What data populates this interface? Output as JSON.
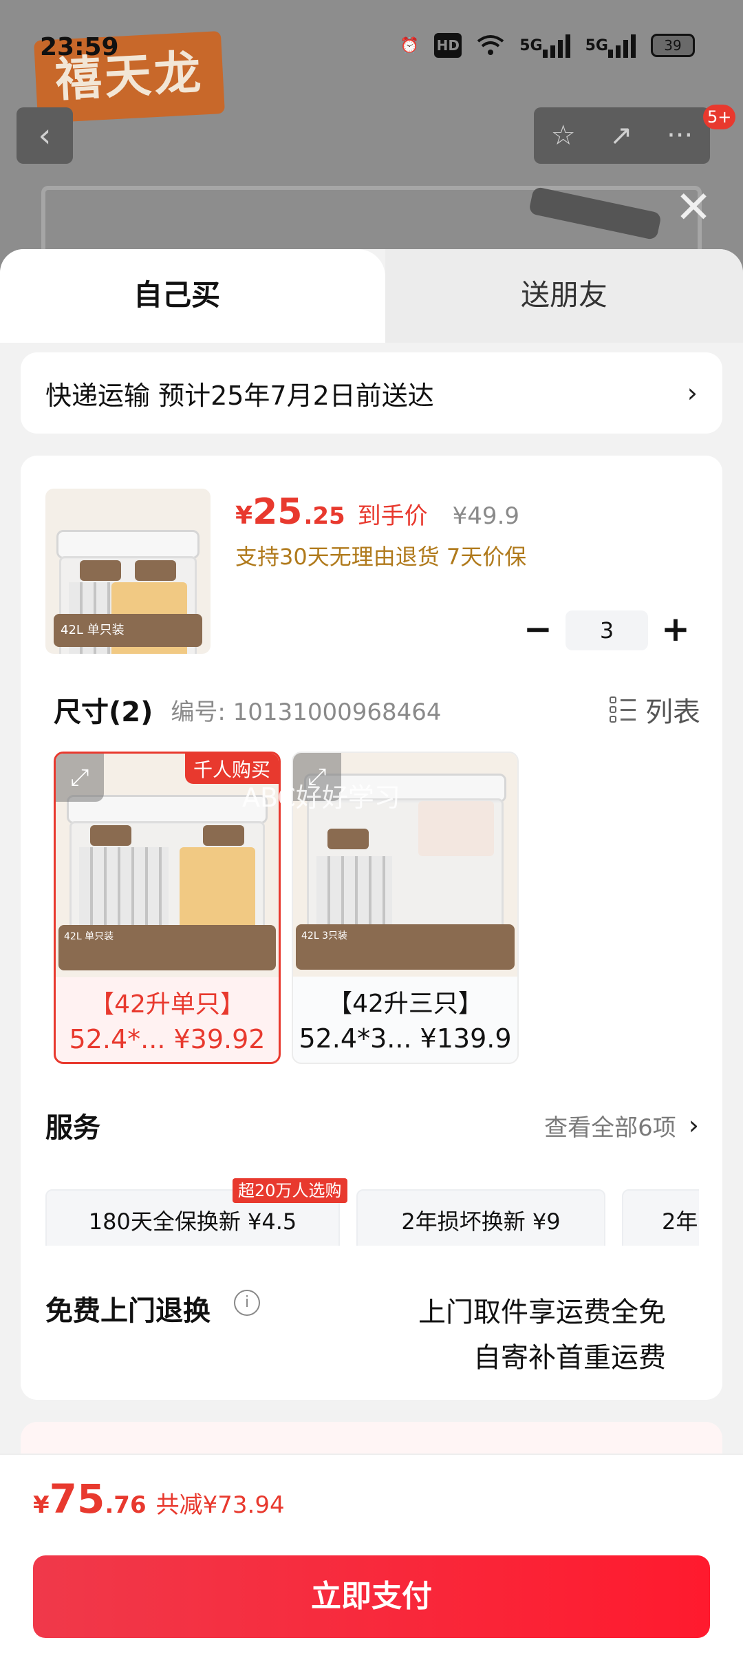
{
  "status_bar": {
    "time": "23:59",
    "hd": "HD",
    "net1": "5G",
    "net2": "5G",
    "battery": "39"
  },
  "brand": {
    "logo_text": "禧天龙"
  },
  "nav": {
    "back": "‹",
    "favorite": "☆",
    "share": "↗",
    "more": "···",
    "badge": "5+",
    "close": "✕"
  },
  "tabs": {
    "self": "自己买",
    "gift": "送朋友"
  },
  "shipping": {
    "text": "快递运输 预计25年7月2日前送达",
    "chevron": "›"
  },
  "product": {
    "currency": "¥",
    "price_int": "25",
    "price_dec": ".25",
    "price_label": "到手价",
    "original_price": "¥49.9",
    "tagline": "支持30天无理由退货 7天价保",
    "quantity": "3",
    "minus": "−",
    "plus": "+",
    "thumb_tag": "42L 单只装"
  },
  "size": {
    "title": "尺寸(2)",
    "code": "编号: 10131000968464",
    "list_label": "列表",
    "variants": [
      {
        "name": "【42升单只】",
        "price": "52.4*... ¥39.92",
        "badge": "千人购买",
        "tag": "42L 单只装",
        "selected": true
      },
      {
        "name": "【42升三只】",
        "price": "52.4*3... ¥139.9",
        "tag": "42L 3只装",
        "selected": false
      }
    ]
  },
  "watermark": "ABC好好学习",
  "services": {
    "title": "服务",
    "more": "查看全部6项",
    "items": [
      {
        "label": "180天全保换新  ¥4.5",
        "badge": "超20万人选购"
      },
      {
        "label": "2年损坏换新  ¥9"
      },
      {
        "label": "2年"
      }
    ]
  },
  "return": {
    "title": "免费上门退换",
    "info": "i",
    "line1": "上门取件享运费全免",
    "line2": "自寄补首重运费"
  },
  "footer": {
    "currency": "¥",
    "total_int": "75",
    "total_dec": ".76",
    "saved": "共减¥73.94",
    "pay": "立即支付"
  },
  "colors": {
    "accent": "#e8392e",
    "gold": "#b07a1c",
    "sheet_bg": "#f2f2f2"
  }
}
